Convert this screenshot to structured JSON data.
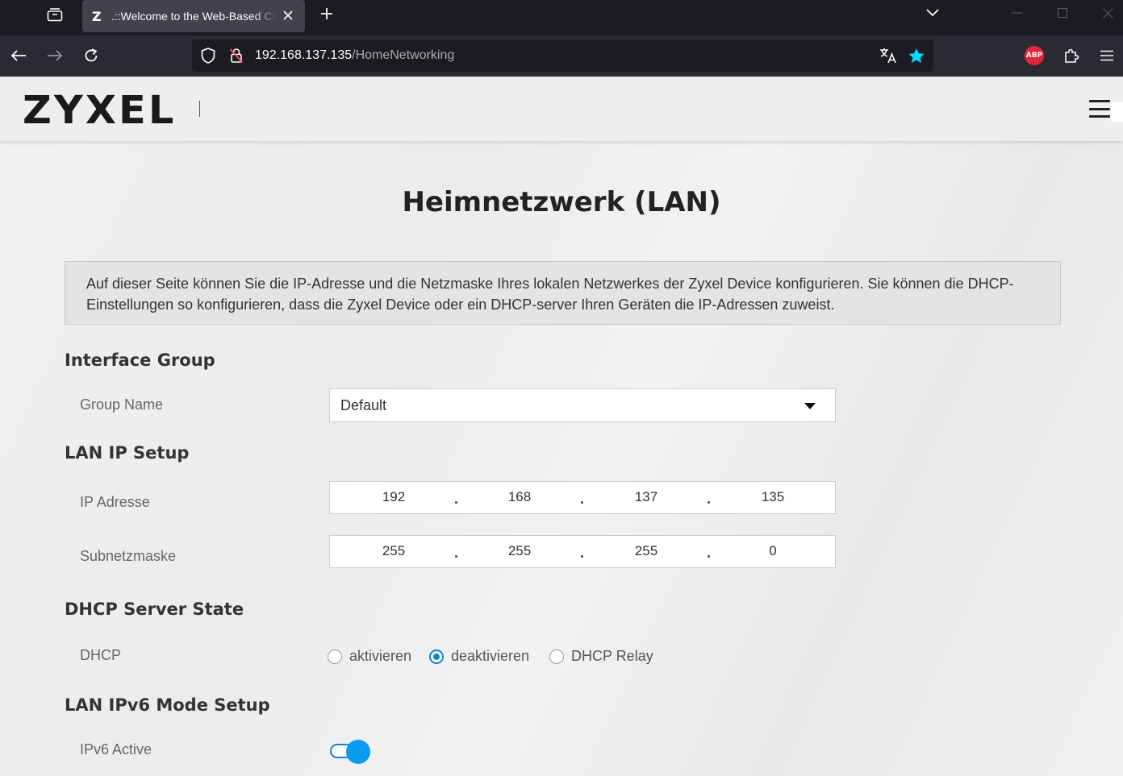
{
  "browser": {
    "tab_favicon": "Z",
    "tab_title": ".::Welcome to the Web-Based Configurator::.",
    "url_host": "192.168.137.135",
    "url_path": "/HomeNetworking",
    "abp_label": "ABP",
    "icons": {
      "tab_overview": "tab-overview-icon",
      "close": "close-icon",
      "new_tab": "plus-icon",
      "tab_list": "chevron-down-icon",
      "back": "arrow-left-icon",
      "forward": "arrow-right-icon",
      "reload": "reload-icon",
      "shield": "shield-icon",
      "insecure": "insecure-lock-icon",
      "translate": "translate-icon",
      "bookmark": "star-icon",
      "extensions": "puzzle-icon",
      "menu": "hamburger-icon"
    },
    "accent_color": "#00ddff"
  },
  "header": {
    "logo": "ZYXEL",
    "menu_icon": "hamburger-icon"
  },
  "page": {
    "title": "Heimnetzwerk (LAN)",
    "info": "Auf dieser Seite können Sie die IP-Adresse und die Netzmaske Ihres lokalen Netzwerkes der Zyxel Device konfigurieren. Sie können die DHCP-Einstellungen so konfigurieren, dass die Zyxel Device oder ein DHCP-server Ihren Geräten die IP-Adressen zuweist.",
    "interface_group": {
      "heading": "Interface Group",
      "group_name_label": "Group Name",
      "group_name_value": "Default"
    },
    "lan_ip": {
      "heading": "LAN IP Setup",
      "ip_label": "IP Adresse",
      "ip": [
        "192",
        "168",
        "137",
        "135"
      ],
      "mask_label": "Subnetzmaske",
      "mask": [
        "255",
        "255",
        "255",
        "0"
      ]
    },
    "dhcp": {
      "heading": "DHCP Server State",
      "label": "DHCP",
      "options": [
        "aktivieren",
        "deaktivieren",
        "DHCP Relay"
      ],
      "selected": "deaktivieren"
    },
    "ipv6": {
      "heading": "LAN IPv6 Mode Setup",
      "active_label": "IPv6 Active",
      "active": true
    },
    "accent_color": "#0a84e0"
  }
}
